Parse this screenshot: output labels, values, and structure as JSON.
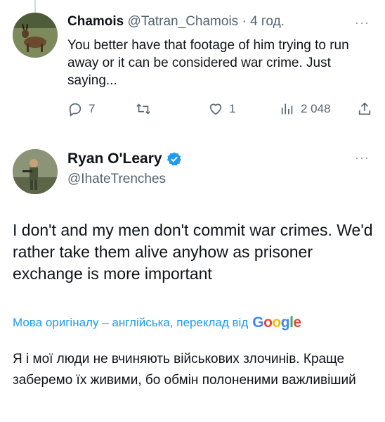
{
  "reply_tweet": {
    "author_name": "Chamois",
    "author_handle": "@Tatran_Chamois",
    "separator": "·",
    "time": "4 год.",
    "text": "You better have that footage of him trying to run away or it can be considered war crime. Just saying...",
    "more_icon": "···",
    "actions": {
      "reply_count": "7",
      "retweet_count": "",
      "like_count": "1",
      "views_count": "2 048"
    }
  },
  "main_tweet": {
    "author_name": "Ryan O'Leary",
    "author_handle": "@IhateTrenches",
    "verified": true,
    "more_icon": "···",
    "text": "I don't and my men don't commit war crimes. We'd rather take them alive anyhow as prisoner exchange is more important",
    "translation_note": "Мова оригіналу – англійська, переклад від",
    "translator_brand": [
      "G",
      "o",
      "o",
      "g",
      "l",
      "e"
    ],
    "translated_text": "Я і мої люди не вчиняють військових злочинів. Краще заберемо їх живими, бо обмін полоненими важливіший"
  },
  "colors": {
    "accent": "#1d9bf0",
    "muted": "#536471",
    "text": "#0f1419",
    "thread_line": "#cfd9de"
  }
}
